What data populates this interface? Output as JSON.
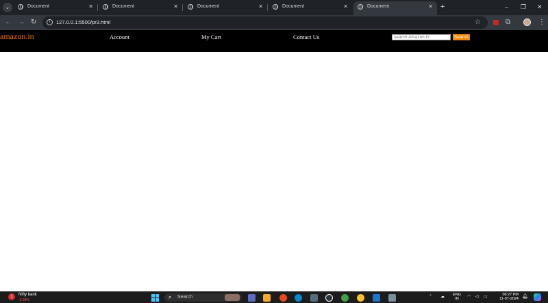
{
  "browser": {
    "tabs": [
      {
        "title": "Document",
        "active": false
      },
      {
        "title": "Document",
        "active": false
      },
      {
        "title": "Document",
        "active": false
      },
      {
        "title": "Document",
        "active": false
      },
      {
        "title": "Document",
        "active": true
      }
    ],
    "new_tab_label": "+",
    "url": "127.0.0.1:5500/pr3.html",
    "window_controls": {
      "minimize": "–",
      "restore": "❐",
      "close": "✕"
    }
  },
  "page": {
    "logo": "amazon.in",
    "nav_links": [
      "Account",
      "My Cart",
      "Contact Us"
    ],
    "search": {
      "placeholder": "search Amazon.in",
      "value": "",
      "button_label": "Search"
    },
    "colors": {
      "navbar_bg": "#000000",
      "logo": "#e47911",
      "search_button": "#f08804"
    }
  },
  "taskbar": {
    "widget": {
      "name": "Nifty bank",
      "value": "-0.93%",
      "badge": "1"
    },
    "search_label": "Search",
    "language": [
      "ENG",
      "IN"
    ],
    "clock": {
      "time": "08:27 PM",
      "date": "11-07-2024"
    }
  }
}
